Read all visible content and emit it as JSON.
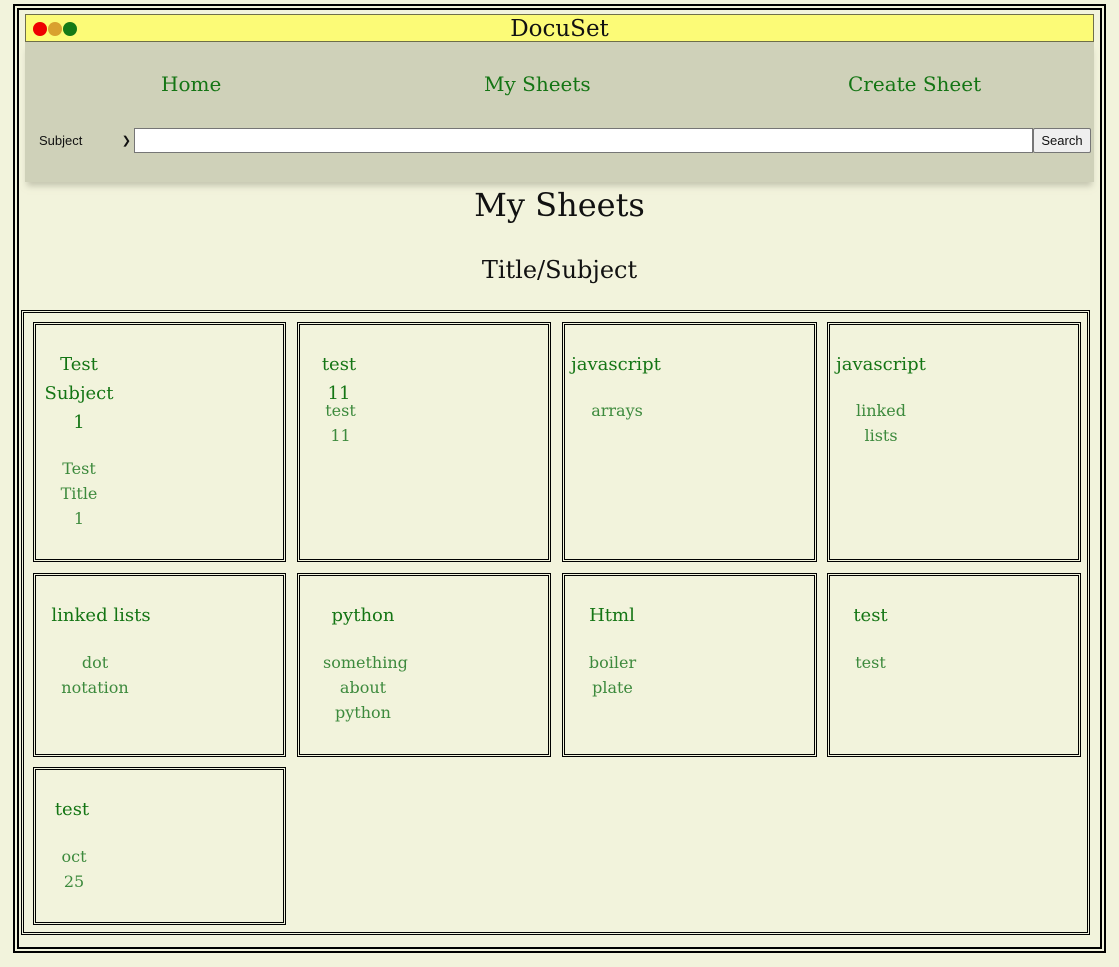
{
  "window": {
    "title": "DocuSet",
    "controls": [
      "close-dot",
      "minimize-dot",
      "maximize-dot"
    ],
    "colors": {
      "close": "#ee0000",
      "minimize": "#d9a12f",
      "maximize": "#157a16"
    }
  },
  "nav": {
    "home": "Home",
    "my_sheets": "My Sheets",
    "create_sheet": "Create Sheet"
  },
  "search": {
    "filter_selected": "Subject",
    "query": "",
    "button_label": "Search"
  },
  "page": {
    "title": "My Sheets",
    "subtitle": "Title/Subject"
  },
  "colors": {
    "background": "#f2f3dc",
    "titlebar": "#fcfb77",
    "header": "#cfd1b9",
    "link": "#147514"
  },
  "sheets": [
    {
      "subject": "Test Subject 1",
      "title": "Test Title 1"
    },
    {
      "subject": "test 11",
      "title": "test 11"
    },
    {
      "subject": "javascript",
      "title": "arrays"
    },
    {
      "subject": "javascript",
      "title": "linked lists"
    },
    {
      "subject": "linked lists",
      "title": "dot notation"
    },
    {
      "subject": "python",
      "title": "something about python"
    },
    {
      "subject": "Html",
      "title": "boiler plate"
    },
    {
      "subject": "test",
      "title": "test"
    },
    {
      "subject": "test",
      "title": "oct 25"
    }
  ]
}
